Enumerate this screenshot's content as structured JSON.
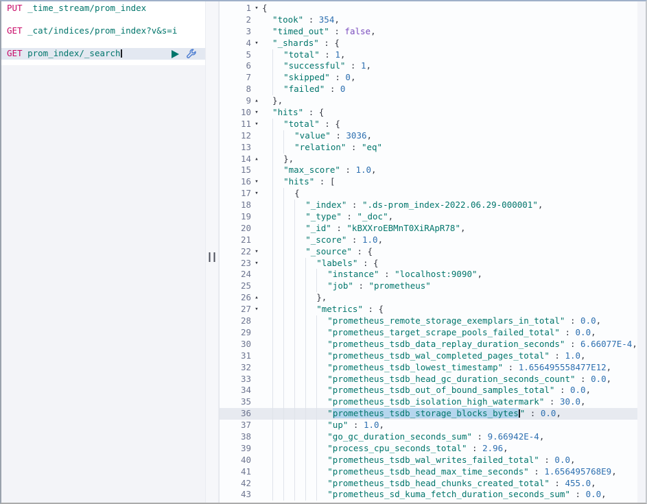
{
  "colors": {
    "method": "#c80a68",
    "key_string": "#00756b",
    "number": "#2d6fb0",
    "boolean": "#7a4dbe",
    "punctuation": "#343741",
    "selection": "#b5d6ee",
    "active_line_bg": "#e7eaf0",
    "request_active_bg": "#e3e8f1",
    "play_icon": "#00756b",
    "wrench_icon": "#4a7bd0",
    "line_number": "#6d7590"
  },
  "request_editor": {
    "rows": [
      {
        "method": "PUT",
        "path": "_time_stream/prom_index"
      },
      {
        "blank": true
      },
      {
        "method": "GET",
        "path": "_cat/indices/prom_index?v&s=i"
      },
      {
        "blank": true
      },
      {
        "method": "GET",
        "path": "prom_index/_search",
        "active": true,
        "cursor": true,
        "icons": [
          "play-icon",
          "wrench-icon"
        ]
      }
    ]
  },
  "response_editor": {
    "active_line": 36,
    "selected_text": "prometheus_tsdb_storage_blocks_bytes",
    "lines": [
      {
        "n": 1,
        "fold": "open",
        "ind": 0,
        "toks": [
          [
            "p",
            "{"
          ]
        ]
      },
      {
        "n": 2,
        "ind": 2,
        "toks": [
          [
            "k",
            "\"took\""
          ],
          [
            "p",
            " : "
          ],
          [
            "n",
            "354"
          ],
          [
            "p",
            ","
          ]
        ]
      },
      {
        "n": 3,
        "ind": 2,
        "toks": [
          [
            "k",
            "\"timed_out\""
          ],
          [
            "p",
            " : "
          ],
          [
            "b",
            "false"
          ],
          [
            "p",
            ","
          ]
        ]
      },
      {
        "n": 4,
        "fold": "open",
        "ind": 2,
        "toks": [
          [
            "k",
            "\"_shards\""
          ],
          [
            "p",
            " : {"
          ]
        ]
      },
      {
        "n": 5,
        "ind": 4,
        "toks": [
          [
            "k",
            "\"total\""
          ],
          [
            "p",
            " : "
          ],
          [
            "n",
            "1"
          ],
          [
            "p",
            ","
          ]
        ]
      },
      {
        "n": 6,
        "ind": 4,
        "toks": [
          [
            "k",
            "\"successful\""
          ],
          [
            "p",
            " : "
          ],
          [
            "n",
            "1"
          ],
          [
            "p",
            ","
          ]
        ]
      },
      {
        "n": 7,
        "ind": 4,
        "toks": [
          [
            "k",
            "\"skipped\""
          ],
          [
            "p",
            " : "
          ],
          [
            "n",
            "0"
          ],
          [
            "p",
            ","
          ]
        ]
      },
      {
        "n": 8,
        "ind": 4,
        "toks": [
          [
            "k",
            "\"failed\""
          ],
          [
            "p",
            " : "
          ],
          [
            "n",
            "0"
          ]
        ]
      },
      {
        "n": 9,
        "fold": "close",
        "ind": 2,
        "toks": [
          [
            "p",
            "},"
          ]
        ]
      },
      {
        "n": 10,
        "fold": "open",
        "ind": 2,
        "toks": [
          [
            "k",
            "\"hits\""
          ],
          [
            "p",
            " : {"
          ]
        ]
      },
      {
        "n": 11,
        "fold": "open",
        "ind": 4,
        "toks": [
          [
            "k",
            "\"total\""
          ],
          [
            "p",
            " : {"
          ]
        ]
      },
      {
        "n": 12,
        "ind": 6,
        "toks": [
          [
            "k",
            "\"value\""
          ],
          [
            "p",
            " : "
          ],
          [
            "n",
            "3036"
          ],
          [
            "p",
            ","
          ]
        ]
      },
      {
        "n": 13,
        "ind": 6,
        "toks": [
          [
            "k",
            "\"relation\""
          ],
          [
            "p",
            " : "
          ],
          [
            "s",
            "\"eq\""
          ]
        ]
      },
      {
        "n": 14,
        "fold": "close",
        "ind": 4,
        "toks": [
          [
            "p",
            "},"
          ]
        ]
      },
      {
        "n": 15,
        "ind": 4,
        "toks": [
          [
            "k",
            "\"max_score\""
          ],
          [
            "p",
            " : "
          ],
          [
            "n",
            "1.0"
          ],
          [
            "p",
            ","
          ]
        ]
      },
      {
        "n": 16,
        "fold": "open",
        "ind": 4,
        "toks": [
          [
            "k",
            "\"hits\""
          ],
          [
            "p",
            " : ["
          ]
        ]
      },
      {
        "n": 17,
        "fold": "open",
        "ind": 6,
        "toks": [
          [
            "p",
            "{"
          ]
        ]
      },
      {
        "n": 18,
        "ind": 8,
        "toks": [
          [
            "k",
            "\"_index\""
          ],
          [
            "p",
            " : "
          ],
          [
            "s",
            "\".ds-prom_index-2022.06.29-000001\""
          ],
          [
            "p",
            ","
          ]
        ]
      },
      {
        "n": 19,
        "ind": 8,
        "toks": [
          [
            "k",
            "\"_type\""
          ],
          [
            "p",
            " : "
          ],
          [
            "s",
            "\"_doc\""
          ],
          [
            "p",
            ","
          ]
        ]
      },
      {
        "n": 20,
        "ind": 8,
        "toks": [
          [
            "k",
            "\"_id\""
          ],
          [
            "p",
            " : "
          ],
          [
            "s",
            "\"kBXXroEBMnT0XiRApR78\""
          ],
          [
            "p",
            ","
          ]
        ]
      },
      {
        "n": 21,
        "ind": 8,
        "toks": [
          [
            "k",
            "\"_score\""
          ],
          [
            "p",
            " : "
          ],
          [
            "n",
            "1.0"
          ],
          [
            "p",
            ","
          ]
        ]
      },
      {
        "n": 22,
        "fold": "open",
        "ind": 8,
        "toks": [
          [
            "k",
            "\"_source\""
          ],
          [
            "p",
            " : {"
          ]
        ]
      },
      {
        "n": 23,
        "fold": "open",
        "ind": 10,
        "toks": [
          [
            "k",
            "\"labels\""
          ],
          [
            "p",
            " : {"
          ]
        ]
      },
      {
        "n": 24,
        "ind": 12,
        "toks": [
          [
            "k",
            "\"instance\""
          ],
          [
            "p",
            " : "
          ],
          [
            "s",
            "\"localhost:9090\""
          ],
          [
            "p",
            ","
          ]
        ]
      },
      {
        "n": 25,
        "ind": 12,
        "toks": [
          [
            "k",
            "\"job\""
          ],
          [
            "p",
            " : "
          ],
          [
            "s",
            "\"prometheus\""
          ]
        ]
      },
      {
        "n": 26,
        "fold": "close",
        "ind": 10,
        "toks": [
          [
            "p",
            "},"
          ]
        ]
      },
      {
        "n": 27,
        "fold": "open",
        "ind": 10,
        "toks": [
          [
            "k",
            "\"metrics\""
          ],
          [
            "p",
            " : {"
          ]
        ]
      },
      {
        "n": 28,
        "ind": 12,
        "toks": [
          [
            "k",
            "\"prometheus_remote_storage_exemplars_in_total\""
          ],
          [
            "p",
            " : "
          ],
          [
            "n",
            "0.0"
          ],
          [
            "p",
            ","
          ]
        ]
      },
      {
        "n": 29,
        "ind": 12,
        "toks": [
          [
            "k",
            "\"prometheus_target_scrape_pools_failed_total\""
          ],
          [
            "p",
            " : "
          ],
          [
            "n",
            "0.0"
          ],
          [
            "p",
            ","
          ]
        ]
      },
      {
        "n": 30,
        "ind": 12,
        "toks": [
          [
            "k",
            "\"prometheus_tsdb_data_replay_duration_seconds\""
          ],
          [
            "p",
            " : "
          ],
          [
            "n",
            "6.66077E-4"
          ],
          [
            "p",
            ","
          ]
        ]
      },
      {
        "n": 31,
        "ind": 12,
        "toks": [
          [
            "k",
            "\"prometheus_tsdb_wal_completed_pages_total\""
          ],
          [
            "p",
            " : "
          ],
          [
            "n",
            "1.0"
          ],
          [
            "p",
            ","
          ]
        ]
      },
      {
        "n": 32,
        "ind": 12,
        "toks": [
          [
            "k",
            "\"prometheus_tsdb_lowest_timestamp\""
          ],
          [
            "p",
            " : "
          ],
          [
            "n",
            "1.656495558477E12"
          ],
          [
            "p",
            ","
          ]
        ]
      },
      {
        "n": 33,
        "ind": 12,
        "toks": [
          [
            "k",
            "\"prometheus_tsdb_head_gc_duration_seconds_count\""
          ],
          [
            "p",
            " : "
          ],
          [
            "n",
            "0.0"
          ],
          [
            "p",
            ","
          ]
        ]
      },
      {
        "n": 34,
        "ind": 12,
        "toks": [
          [
            "k",
            "\"prometheus_tsdb_out_of_bound_samples_total\""
          ],
          [
            "p",
            " : "
          ],
          [
            "n",
            "0.0"
          ],
          [
            "p",
            ","
          ]
        ]
      },
      {
        "n": 35,
        "ind": 12,
        "toks": [
          [
            "k",
            "\"prometheus_tsdb_isolation_high_watermark\""
          ],
          [
            "p",
            " : "
          ],
          [
            "n",
            "30.0"
          ],
          [
            "p",
            ","
          ]
        ]
      },
      {
        "n": 36,
        "active": true,
        "ind": 12,
        "toks": [
          [
            "k",
            "\""
          ],
          [
            "sel",
            "prometheus_tsdb_storage_blocks_bytes"
          ],
          [
            "cur",
            ""
          ],
          [
            "k",
            "\""
          ],
          [
            "p",
            " : "
          ],
          [
            "n",
            "0.0"
          ],
          [
            "p",
            ","
          ]
        ]
      },
      {
        "n": 37,
        "ind": 12,
        "toks": [
          [
            "k",
            "\"up\""
          ],
          [
            "p",
            " : "
          ],
          [
            "n",
            "1.0"
          ],
          [
            "p",
            ","
          ]
        ]
      },
      {
        "n": 38,
        "ind": 12,
        "toks": [
          [
            "k",
            "\"go_gc_duration_seconds_sum\""
          ],
          [
            "p",
            " : "
          ],
          [
            "n",
            "9.66942E-4"
          ],
          [
            "p",
            ","
          ]
        ]
      },
      {
        "n": 39,
        "ind": 12,
        "toks": [
          [
            "k",
            "\"process_cpu_seconds_total\""
          ],
          [
            "p",
            " : "
          ],
          [
            "n",
            "2.96"
          ],
          [
            "p",
            ","
          ]
        ]
      },
      {
        "n": 40,
        "ind": 12,
        "toks": [
          [
            "k",
            "\"prometheus_tsdb_wal_writes_failed_total\""
          ],
          [
            "p",
            " : "
          ],
          [
            "n",
            "0.0"
          ],
          [
            "p",
            ","
          ]
        ]
      },
      {
        "n": 41,
        "ind": 12,
        "toks": [
          [
            "k",
            "\"prometheus_tsdb_head_max_time_seconds\""
          ],
          [
            "p",
            " : "
          ],
          [
            "n",
            "1.656495768E9"
          ],
          [
            "p",
            ","
          ]
        ]
      },
      {
        "n": 42,
        "ind": 12,
        "toks": [
          [
            "k",
            "\"prometheus_tsdb_head_chunks_created_total\""
          ],
          [
            "p",
            " : "
          ],
          [
            "n",
            "455.0"
          ],
          [
            "p",
            ","
          ]
        ]
      },
      {
        "n": 43,
        "ind": 12,
        "toks": [
          [
            "k",
            "\"prometheus_sd_kuma_fetch_duration_seconds_sum\""
          ],
          [
            "p",
            " : "
          ],
          [
            "n",
            "0.0"
          ],
          [
            "p",
            ","
          ]
        ]
      }
    ]
  }
}
